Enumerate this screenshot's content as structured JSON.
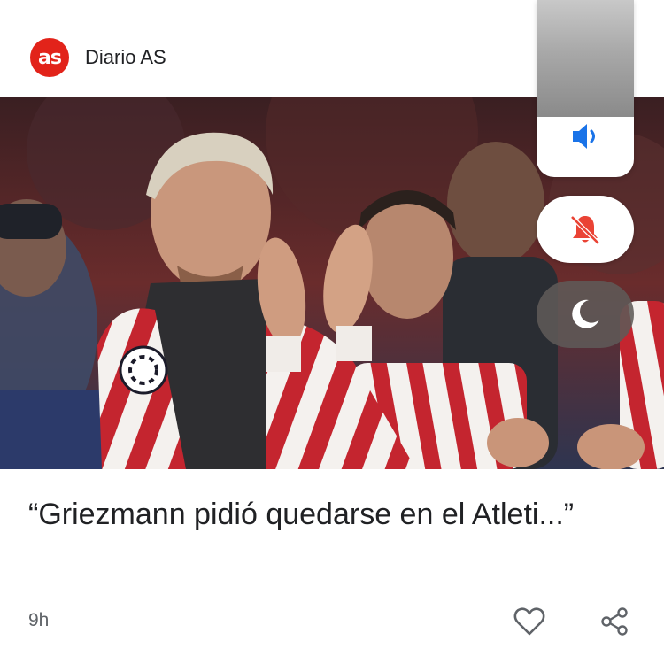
{
  "header": {
    "logo_text": "as",
    "publisher": "Diario AS"
  },
  "article": {
    "headline": "“Griezmann pidió quedarse en el Atleti...”",
    "time": "9h",
    "image_alt": "Griezmann applauding in Atlético de Madrid kit"
  },
  "actions": {
    "like_icon": "heart-outline-icon",
    "share_icon": "share-icon"
  },
  "volume_panel": {
    "level": 0.66,
    "volume_icon": "speaker-icon",
    "mute_icon": "bell-off-icon",
    "dnd_icon": "moon-icon"
  },
  "colors": {
    "brand": "#e2231a",
    "volume_accent": "#1a73e8",
    "mute_accent": "#ea4335"
  }
}
